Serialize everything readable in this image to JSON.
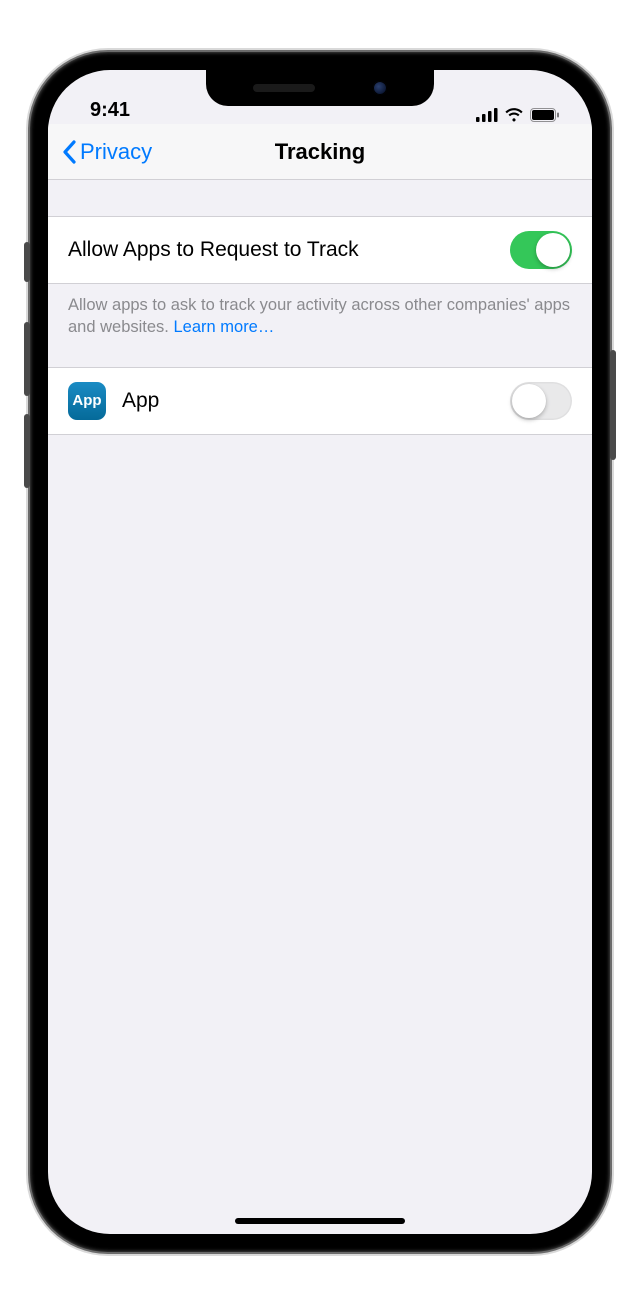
{
  "status": {
    "time": "9:41"
  },
  "nav": {
    "back_label": "Privacy",
    "title": "Tracking"
  },
  "allow_tracking": {
    "label": "Allow Apps to Request to Track",
    "enabled": true,
    "footer": "Allow apps to ask to track your activity across other companies' apps and websites. ",
    "learn_more": "Learn more…"
  },
  "apps": [
    {
      "name": "App",
      "icon_text": "App",
      "enabled": false
    }
  ]
}
